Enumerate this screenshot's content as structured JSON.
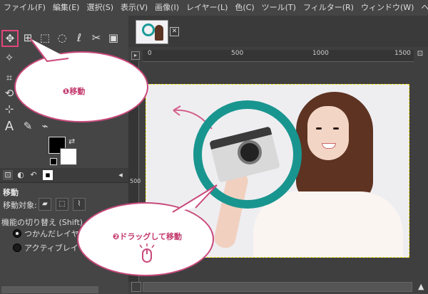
{
  "menu": [
    "ファイル(F)",
    "編集(E)",
    "選択(S)",
    "表示(V)",
    "画像(I)",
    "レイヤー(L)",
    "色(C)",
    "ツール(T)",
    "フィルター(R)",
    "ウィンドウ(W)",
    "ヘルプ(H)"
  ],
  "toolbox": {
    "active_tool": "move-tool"
  },
  "tool_options": {
    "title": "移動",
    "move_target_label": "移動対象:",
    "toggle_label": "機能の切り替え (Shift)",
    "radio1": "つかんだレイヤー",
    "radio2": "アクティブレイヤー"
  },
  "ruler": {
    "top_labels": [
      "0",
      "500",
      "1000",
      "1500"
    ],
    "left_labels": "500"
  },
  "callouts": {
    "one": "❶移動",
    "two": "❷ドラッグして移動"
  },
  "colors": {
    "accent": "#c94a7b",
    "ring": "#19958f",
    "selection": "#f2e51a"
  },
  "icons": {
    "move": "move-icon",
    "drag_mouse": "mouse-icon"
  }
}
